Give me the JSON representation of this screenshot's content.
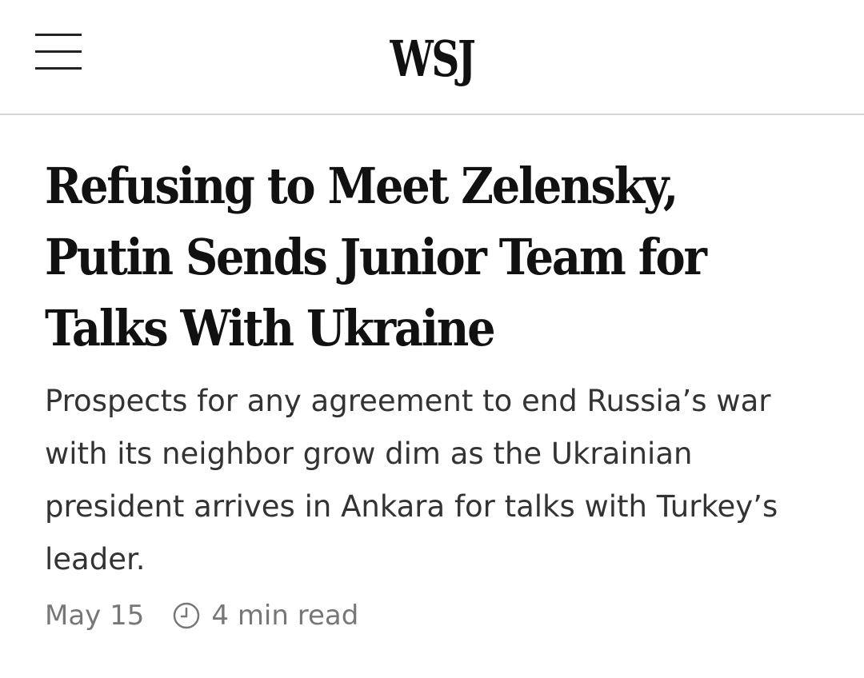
{
  "header": {
    "logo": "WSJ",
    "menu_icon": "hamburger-menu-icon"
  },
  "article": {
    "headline": "Refusing to Meet Zelensky, Putin Sends Junior Team for Talks With Ukraine",
    "dek": "Prospects for any agreement to end Russia’s war with its neighbor grow dim as the Ukrainian president arrives in Ankara for talks with Turkey’s leader.",
    "date": "May 15",
    "read_time": "4 min read",
    "read_time_icon": "clock-icon"
  },
  "colors": {
    "text": "#111111",
    "dek_text": "#333333",
    "meta_text": "#777777",
    "divider": "#d4d4d4",
    "background": "#ffffff"
  }
}
